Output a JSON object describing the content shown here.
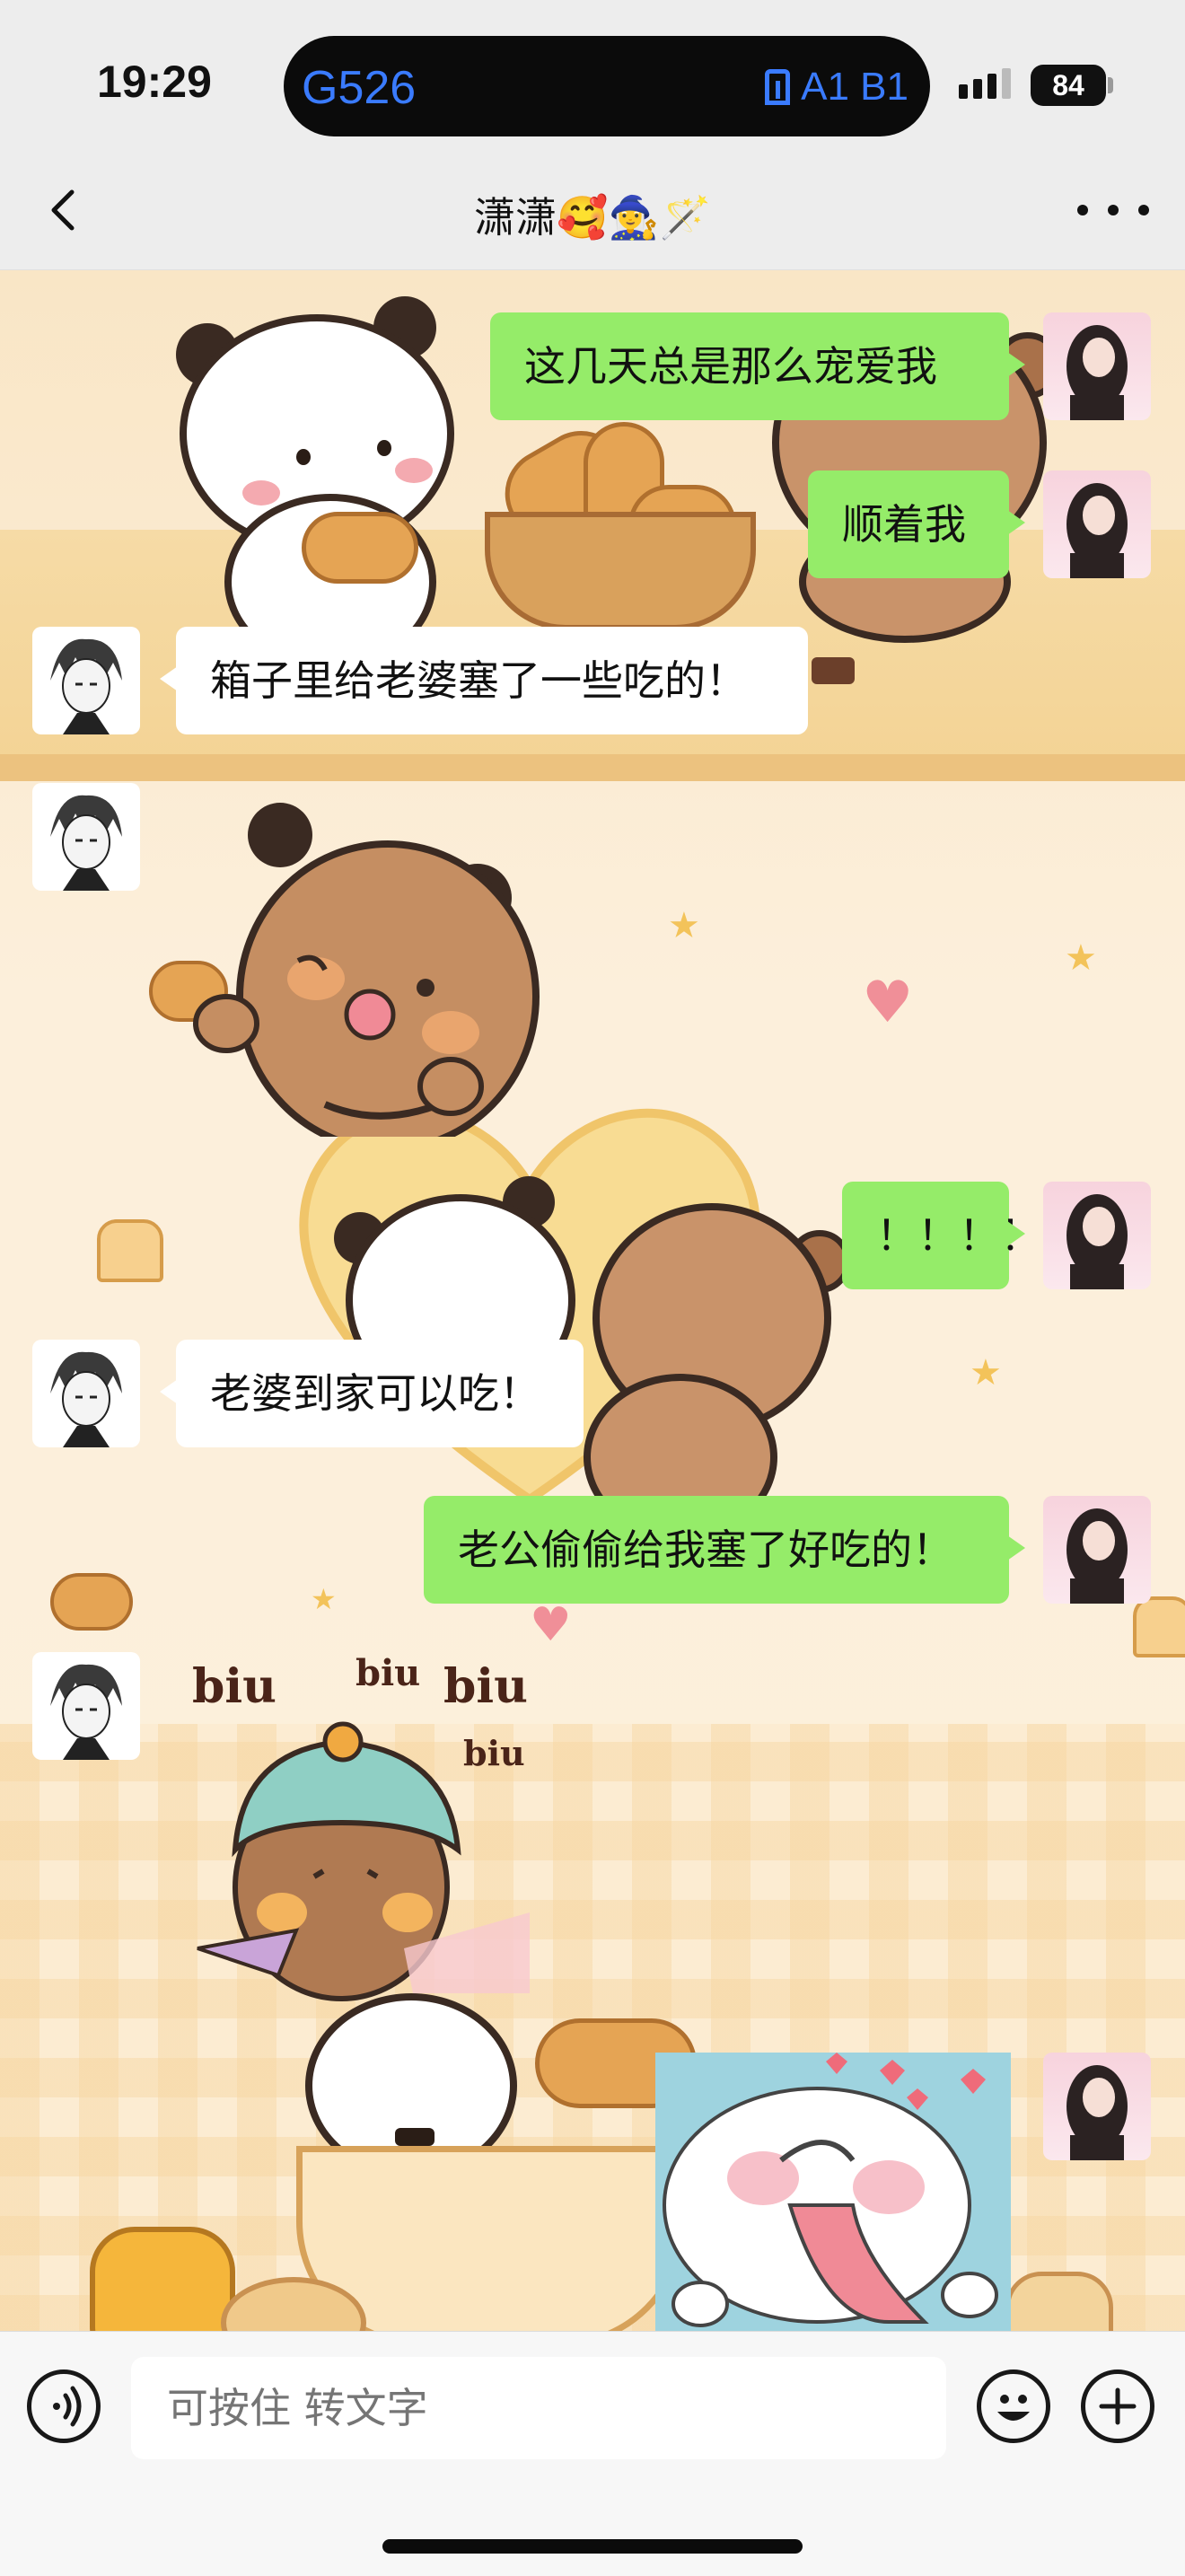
{
  "status_bar": {
    "time": "19:29",
    "island_left": "G526",
    "island_right": "A1 B1",
    "battery": "84",
    "icons": [
      "door-icon",
      "signal-icon",
      "battery-icon"
    ]
  },
  "nav": {
    "title": "潇潇🥰🧙‍♀️🪄",
    "icons": [
      "back-chevron-icon",
      "more-dots-icon"
    ]
  },
  "messages": [
    {
      "side": "right",
      "type": "text",
      "text": "这几天总是那么宠爱我"
    },
    {
      "side": "right",
      "type": "text",
      "text": "顺着我"
    },
    {
      "side": "left",
      "type": "text",
      "text": "箱子里给老婆塞了一些吃的！"
    },
    {
      "side": "left",
      "type": "sticker",
      "sticker": "brown-bear-blushing-sticker"
    },
    {
      "side": "right",
      "type": "text",
      "text": "！！！！"
    },
    {
      "side": "left",
      "type": "text",
      "text": "老婆到家可以吃！"
    },
    {
      "side": "right",
      "type": "text",
      "text": "老公偷偷给我塞了好吃的！"
    },
    {
      "side": "left",
      "type": "sticker",
      "sticker": "bear-helmet-biu-sticker",
      "sticker_text": [
        "biu",
        "biu",
        "biu",
        "biu"
      ]
    },
    {
      "side": "right",
      "type": "sticker",
      "sticker": "white-dog-hearts-sticker"
    }
  ],
  "input_bar": {
    "placeholder": "可按住 转文字",
    "icons": [
      "voice-icon",
      "emoji-icon",
      "plus-icon"
    ]
  },
  "colors": {
    "bubble_self": "#95ec69",
    "bubble_other": "#ffffff",
    "bar_bg": "#ededed",
    "island_text": "#3a7bff"
  }
}
